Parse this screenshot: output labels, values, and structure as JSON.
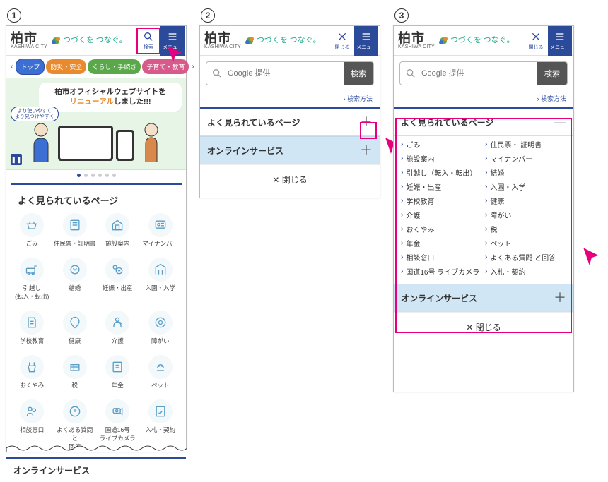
{
  "steps": [
    "1",
    "2",
    "3"
  ],
  "header": {
    "city": "柏市",
    "city_en": "KASHIWA CITY",
    "tagline": "つづくを つなぐ。",
    "search_label": "検索",
    "close_label": "閉じる",
    "menu_label": "メニュー"
  },
  "nav": {
    "top": "トップ",
    "safety": "防災・安全",
    "life": "くらし・手続き",
    "child": "子育て・教育"
  },
  "hero": {
    "line1": "柏市オフィシャルウェブサイトを",
    "line2_a": "リニューアル",
    "line2_b": "しました!!!",
    "badge_l1": "より使いやすく",
    "badge_l2": "より見つけやすく"
  },
  "popular_title": "よく見られているページ",
  "online_title": "オンラインサービス",
  "close_row": "閉じる",
  "search": {
    "placeholder": "Google 提供",
    "go": "検索",
    "method": "検索方法"
  },
  "items": [
    "ごみ",
    "住民票・ 証明書",
    "施設案内",
    "マイナンバー",
    "引越し（転入・転出）",
    "結婚",
    "妊娠・出産",
    "入園・入学",
    "学校教育",
    "健康",
    "介護",
    "障がい",
    "おくやみ",
    "税",
    "年金",
    "ペット",
    "相談窓口",
    "よくある質問 と回答",
    "国道16号 ライブカメラ",
    "入札・契約"
  ],
  "items_short": [
    "ごみ",
    "住民票・証明書",
    "施設案内",
    "マイナンバー",
    "引越し\n(転入・転出)",
    "結婚",
    "妊娠・出産",
    "入園・入学",
    "学校教育",
    "健康",
    "介護",
    "障がい",
    "おくやみ",
    "税",
    "年金",
    "ペット",
    "相談窓口",
    "よくある質問 と\n回答",
    "国道16号\nライブカメラ",
    "入札・契約"
  ]
}
